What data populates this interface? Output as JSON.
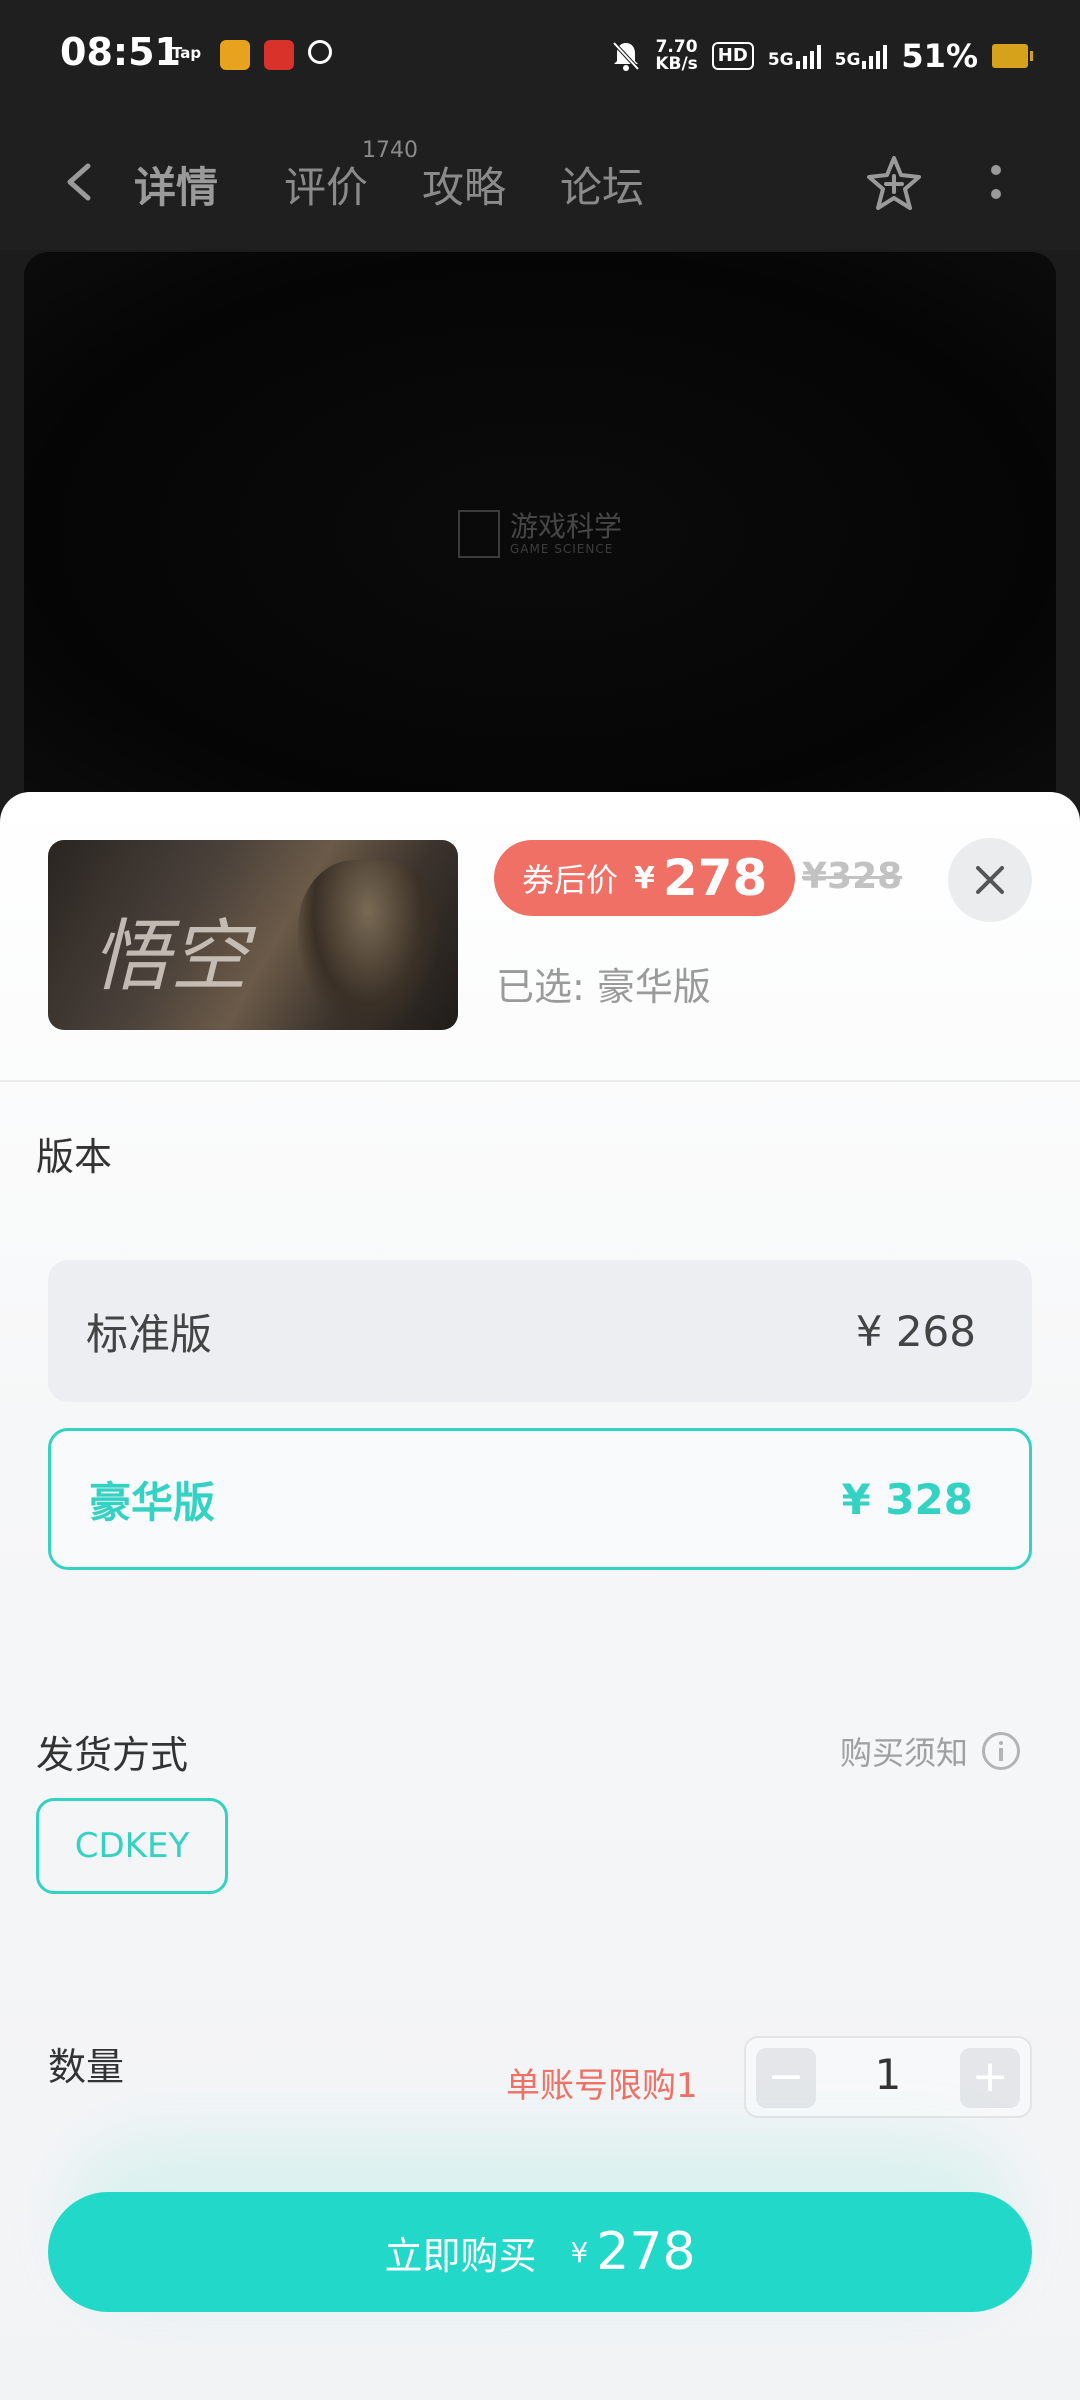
{
  "status_bar": {
    "time": "08:51",
    "speed_value": "7.70",
    "speed_unit": "KB/s",
    "hd": "HD",
    "sig1": "5G",
    "sig2": "5G",
    "battery": "51%"
  },
  "nav": {
    "tabs": [
      "详情",
      "评价",
      "攻略",
      "论坛"
    ],
    "review_count": "1740"
  },
  "video": {
    "logo_cn": "游戏科学",
    "logo_en": "GAME SCIENCE"
  },
  "product": {
    "thumb_title": "悟空",
    "coupon_label": "券后价",
    "currency": "¥",
    "coupon_price": "278",
    "original_price": "¥328",
    "selected_text": "已选: 豪华版"
  },
  "version_section": {
    "title": "版本",
    "options": [
      {
        "name": "标准版",
        "price": "¥ 268"
      },
      {
        "name": "豪华版",
        "price": "¥ 328"
      }
    ]
  },
  "delivery_section": {
    "title": "发货方式",
    "notice": "购买须知",
    "method": "CDKEY"
  },
  "quantity_section": {
    "title": "数量",
    "limit": "单账号限购1",
    "value": "1",
    "minus": "−",
    "plus": "+"
  },
  "buy": {
    "label": "立即购买",
    "currency": "¥",
    "price": "278"
  },
  "colors": {
    "accent": "#33d2c3",
    "buy_button": "#22d8c8",
    "coupon": "#f07065"
  }
}
